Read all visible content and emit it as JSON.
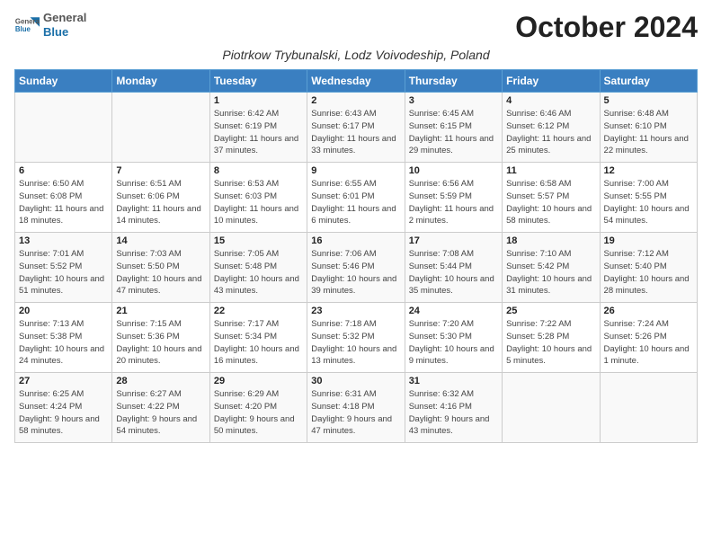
{
  "header": {
    "logo_general": "General",
    "logo_blue": "Blue",
    "month_title": "October 2024",
    "subtitle": "Piotrkow Trybunalski, Lodz Voivodeship, Poland"
  },
  "days_of_week": [
    "Sunday",
    "Monday",
    "Tuesday",
    "Wednesday",
    "Thursday",
    "Friday",
    "Saturday"
  ],
  "weeks": [
    [
      {
        "num": "",
        "info": ""
      },
      {
        "num": "",
        "info": ""
      },
      {
        "num": "1",
        "info": "Sunrise: 6:42 AM\nSunset: 6:19 PM\nDaylight: 11 hours and 37 minutes."
      },
      {
        "num": "2",
        "info": "Sunrise: 6:43 AM\nSunset: 6:17 PM\nDaylight: 11 hours and 33 minutes."
      },
      {
        "num": "3",
        "info": "Sunrise: 6:45 AM\nSunset: 6:15 PM\nDaylight: 11 hours and 29 minutes."
      },
      {
        "num": "4",
        "info": "Sunrise: 6:46 AM\nSunset: 6:12 PM\nDaylight: 11 hours and 25 minutes."
      },
      {
        "num": "5",
        "info": "Sunrise: 6:48 AM\nSunset: 6:10 PM\nDaylight: 11 hours and 22 minutes."
      }
    ],
    [
      {
        "num": "6",
        "info": "Sunrise: 6:50 AM\nSunset: 6:08 PM\nDaylight: 11 hours and 18 minutes."
      },
      {
        "num": "7",
        "info": "Sunrise: 6:51 AM\nSunset: 6:06 PM\nDaylight: 11 hours and 14 minutes."
      },
      {
        "num": "8",
        "info": "Sunrise: 6:53 AM\nSunset: 6:03 PM\nDaylight: 11 hours and 10 minutes."
      },
      {
        "num": "9",
        "info": "Sunrise: 6:55 AM\nSunset: 6:01 PM\nDaylight: 11 hours and 6 minutes."
      },
      {
        "num": "10",
        "info": "Sunrise: 6:56 AM\nSunset: 5:59 PM\nDaylight: 11 hours and 2 minutes."
      },
      {
        "num": "11",
        "info": "Sunrise: 6:58 AM\nSunset: 5:57 PM\nDaylight: 10 hours and 58 minutes."
      },
      {
        "num": "12",
        "info": "Sunrise: 7:00 AM\nSunset: 5:55 PM\nDaylight: 10 hours and 54 minutes."
      }
    ],
    [
      {
        "num": "13",
        "info": "Sunrise: 7:01 AM\nSunset: 5:52 PM\nDaylight: 10 hours and 51 minutes."
      },
      {
        "num": "14",
        "info": "Sunrise: 7:03 AM\nSunset: 5:50 PM\nDaylight: 10 hours and 47 minutes."
      },
      {
        "num": "15",
        "info": "Sunrise: 7:05 AM\nSunset: 5:48 PM\nDaylight: 10 hours and 43 minutes."
      },
      {
        "num": "16",
        "info": "Sunrise: 7:06 AM\nSunset: 5:46 PM\nDaylight: 10 hours and 39 minutes."
      },
      {
        "num": "17",
        "info": "Sunrise: 7:08 AM\nSunset: 5:44 PM\nDaylight: 10 hours and 35 minutes."
      },
      {
        "num": "18",
        "info": "Sunrise: 7:10 AM\nSunset: 5:42 PM\nDaylight: 10 hours and 31 minutes."
      },
      {
        "num": "19",
        "info": "Sunrise: 7:12 AM\nSunset: 5:40 PM\nDaylight: 10 hours and 28 minutes."
      }
    ],
    [
      {
        "num": "20",
        "info": "Sunrise: 7:13 AM\nSunset: 5:38 PM\nDaylight: 10 hours and 24 minutes."
      },
      {
        "num": "21",
        "info": "Sunrise: 7:15 AM\nSunset: 5:36 PM\nDaylight: 10 hours and 20 minutes."
      },
      {
        "num": "22",
        "info": "Sunrise: 7:17 AM\nSunset: 5:34 PM\nDaylight: 10 hours and 16 minutes."
      },
      {
        "num": "23",
        "info": "Sunrise: 7:18 AM\nSunset: 5:32 PM\nDaylight: 10 hours and 13 minutes."
      },
      {
        "num": "24",
        "info": "Sunrise: 7:20 AM\nSunset: 5:30 PM\nDaylight: 10 hours and 9 minutes."
      },
      {
        "num": "25",
        "info": "Sunrise: 7:22 AM\nSunset: 5:28 PM\nDaylight: 10 hours and 5 minutes."
      },
      {
        "num": "26",
        "info": "Sunrise: 7:24 AM\nSunset: 5:26 PM\nDaylight: 10 hours and 1 minute."
      }
    ],
    [
      {
        "num": "27",
        "info": "Sunrise: 6:25 AM\nSunset: 4:24 PM\nDaylight: 9 hours and 58 minutes."
      },
      {
        "num": "28",
        "info": "Sunrise: 6:27 AM\nSunset: 4:22 PM\nDaylight: 9 hours and 54 minutes."
      },
      {
        "num": "29",
        "info": "Sunrise: 6:29 AM\nSunset: 4:20 PM\nDaylight: 9 hours and 50 minutes."
      },
      {
        "num": "30",
        "info": "Sunrise: 6:31 AM\nSunset: 4:18 PM\nDaylight: 9 hours and 47 minutes."
      },
      {
        "num": "31",
        "info": "Sunrise: 6:32 AM\nSunset: 4:16 PM\nDaylight: 9 hours and 43 minutes."
      },
      {
        "num": "",
        "info": ""
      },
      {
        "num": "",
        "info": ""
      }
    ]
  ]
}
